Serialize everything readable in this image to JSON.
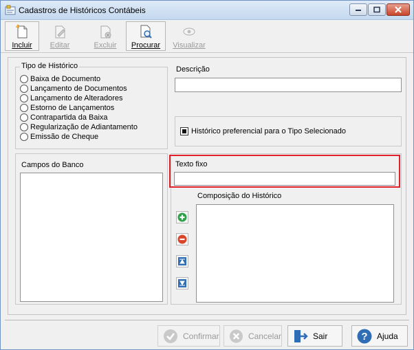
{
  "window": {
    "title": "Cadastros de Históricos Contábeis",
    "accent_color": "#c9452d"
  },
  "toolbar": {
    "buttons": [
      {
        "label": "Incluir",
        "enabled": true,
        "icon": "new-document-icon"
      },
      {
        "label": "Editar",
        "enabled": false,
        "icon": "edit-document-icon"
      },
      {
        "label": "Excluir",
        "enabled": false,
        "icon": "delete-document-icon"
      },
      {
        "label": "Procurar",
        "enabled": true,
        "icon": "search-document-icon"
      },
      {
        "label": "Visualizar",
        "enabled": false,
        "icon": "eye-icon"
      }
    ]
  },
  "tipo_historico": {
    "label": "Tipo de Histórico",
    "options": [
      "Baixa de Documento",
      "Lançamento de Documentos",
      "Lançamento de Alteradores",
      "Estorno de Lançamentos",
      "Contrapartida da Baixa",
      "Regularização de Adiantamento",
      "Emissão de Cheque"
    ]
  },
  "descricao": {
    "label": "Descrição",
    "value": ""
  },
  "preferencial": {
    "label": "Histórico preferencial para o Tipo Selecionado",
    "checked": true
  },
  "campos_banco": {
    "label": "Campos do Banco"
  },
  "texto_fixo": {
    "label": "Texto fixo",
    "value": "",
    "highlight_color": "#e0202b"
  },
  "composicao": {
    "label": "Composição do Histórico"
  },
  "side_buttons": [
    "add-icon",
    "remove-icon",
    "move-up-icon",
    "move-down-icon"
  ],
  "footer": {
    "confirmar": "Confirmar",
    "cancelar": "Cancelar",
    "sair": "Sair",
    "ajuda": "Ajuda"
  }
}
